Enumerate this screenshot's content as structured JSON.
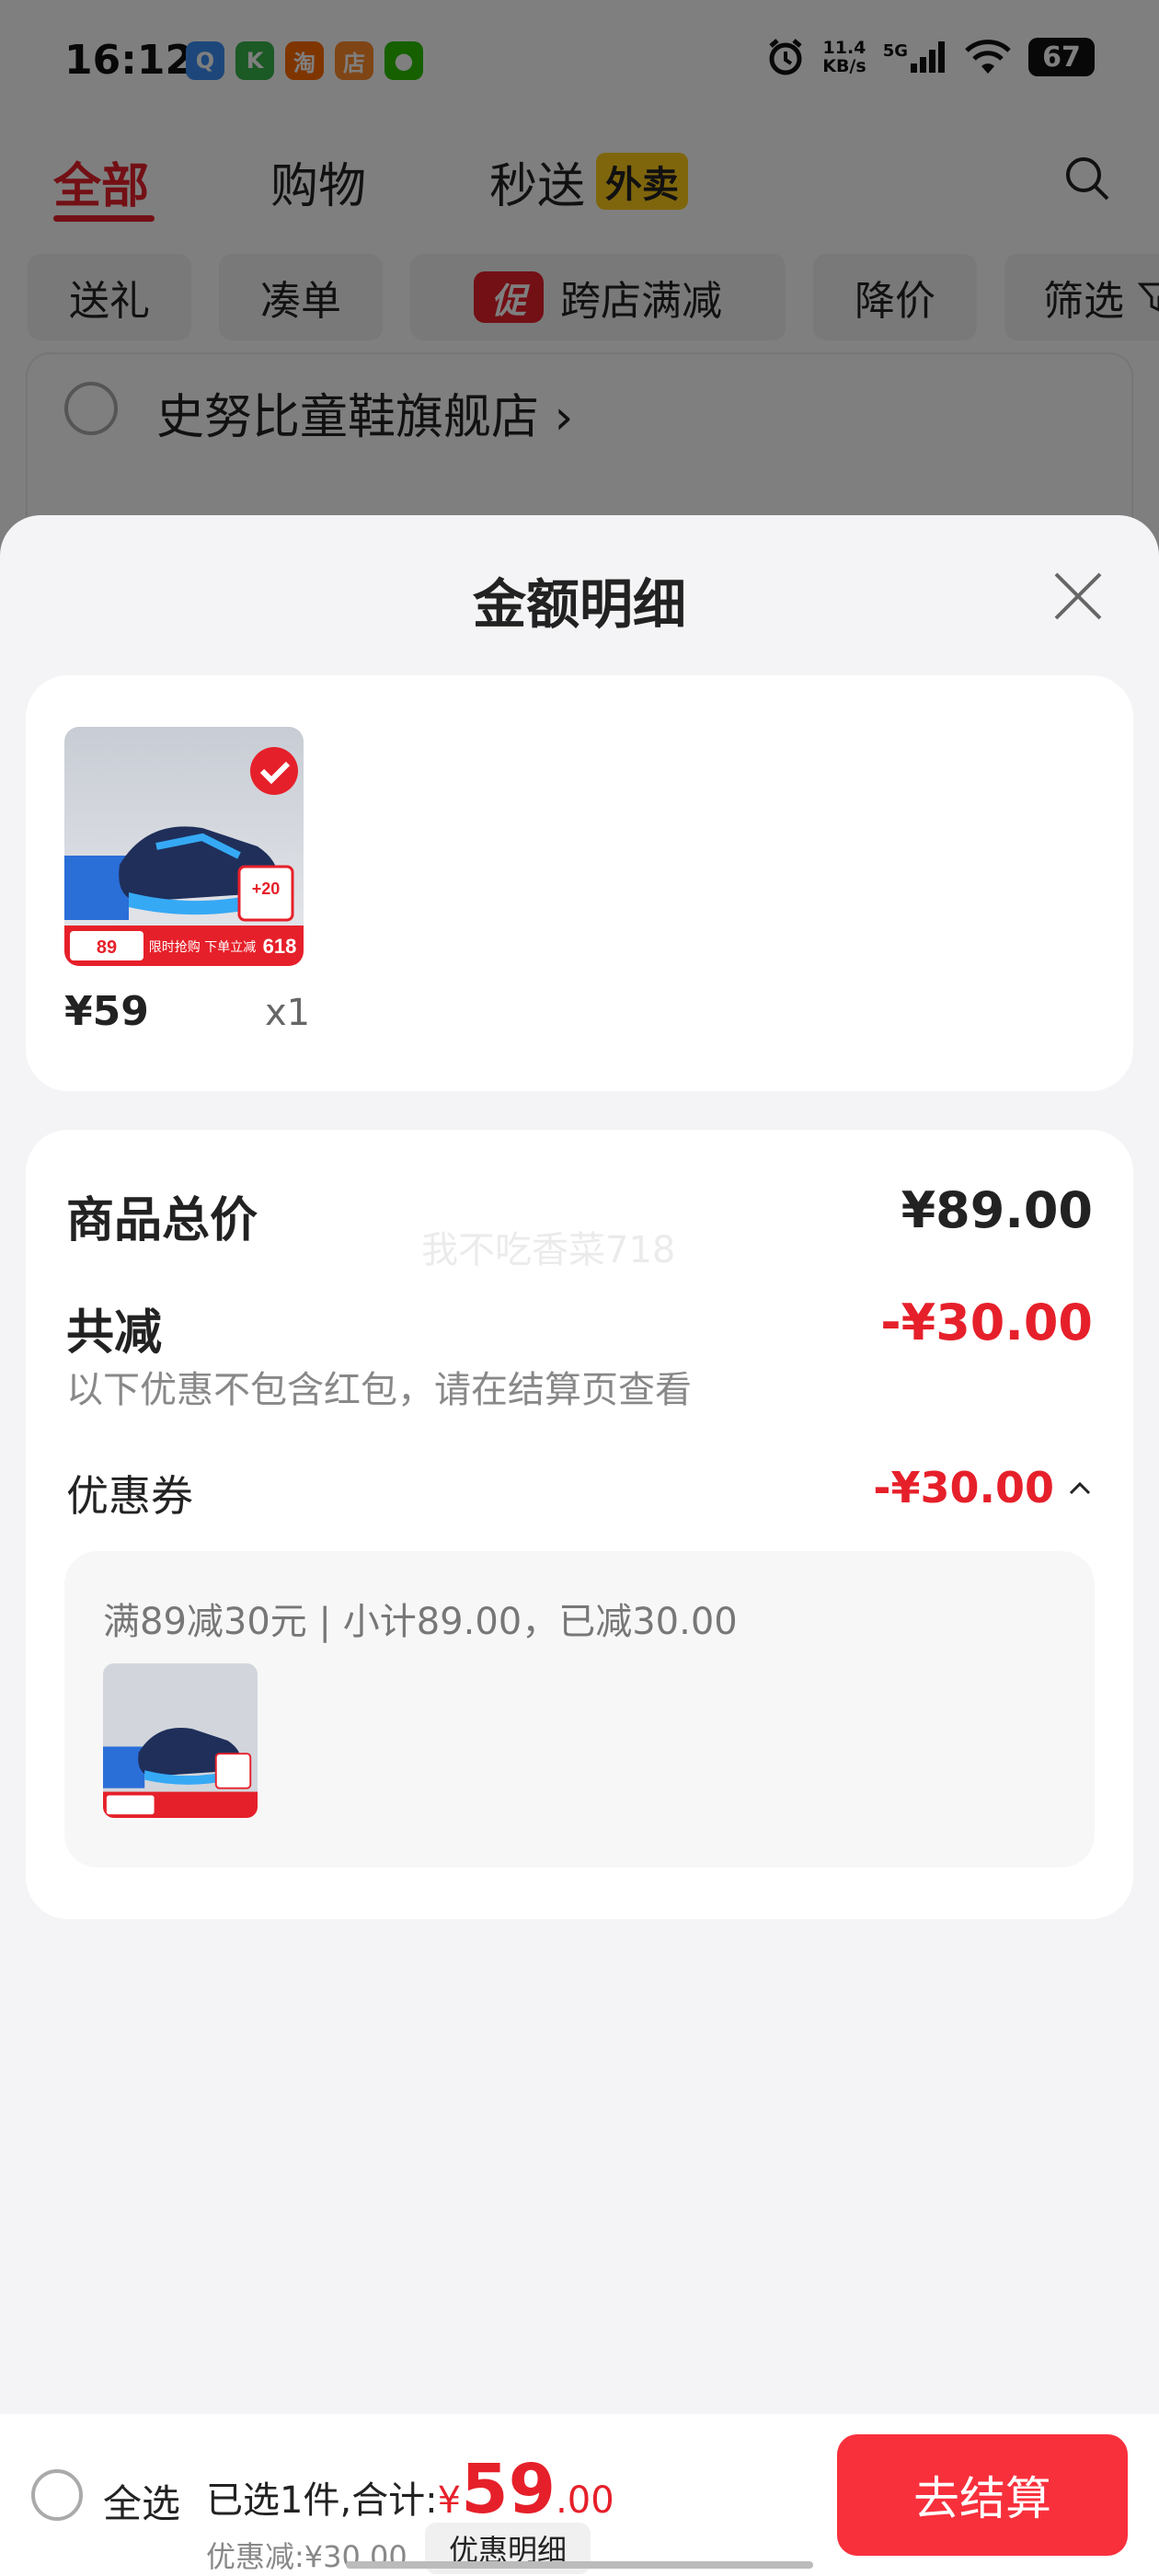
{
  "status_bar": {
    "time": "16:12",
    "net_speed_top": "11.4",
    "net_speed_bottom": "KB/s",
    "signal": "5G",
    "battery": "67",
    "app_icons": [
      {
        "name": "qq-browser-icon",
        "glyph": "Q",
        "color": "#3a8ef6"
      },
      {
        "name": "mini-program-icon",
        "glyph": "K",
        "color": "#36b24a"
      },
      {
        "name": "taobao-icon",
        "glyph": "淘",
        "color": "#ff6a00"
      },
      {
        "name": "shop-icon",
        "glyph": "店",
        "color": "#ff8a2a"
      },
      {
        "name": "wechat-icon",
        "glyph": "●",
        "color": "#2dc100"
      }
    ]
  },
  "tabs": {
    "all": "全部",
    "shopping": "购物",
    "instant": "秒送",
    "instant_badge": "外卖"
  },
  "chips": {
    "gift": "送礼",
    "bundle": "凑单",
    "promo_icon": "促",
    "cross_store": "跨店满减",
    "price_drop": "降价",
    "filter": "筛选"
  },
  "store": {
    "name": "史努比童鞋旗舰店 ›"
  },
  "sheet": {
    "title": "金额明细",
    "product": {
      "price": "¥59",
      "qty": "x1",
      "img_badge_price": "89",
      "img_badge_text": "限时抢购 下单立减",
      "img_badge_618": "618",
      "img_tag": "+20"
    },
    "summary": {
      "total_label": "商品总价",
      "total_value": "¥89.00",
      "discount_label": "共减",
      "discount_value": "-¥30.00",
      "discount_note": "以下优惠不包含红包，请在结算页查看",
      "coupon_label": "优惠券",
      "coupon_value": "-¥30.00",
      "coupon_desc": "满89减30元 | 小计89.00，已减30.00",
      "watermark": "我不吃香菜718"
    }
  },
  "bottom_bar": {
    "select_all": "全选",
    "selected_text": "已选1件,合计:",
    "currency": "¥",
    "total_int": "59",
    "total_dec": ".00",
    "discount_text": "优惠减:¥30.00",
    "detail_button": "优惠明细",
    "checkout_button": "去结算"
  },
  "colors": {
    "accent_red": "#e6202a",
    "checkout_red": "#f8303c",
    "badge_yellow": "#ffcc1a"
  }
}
